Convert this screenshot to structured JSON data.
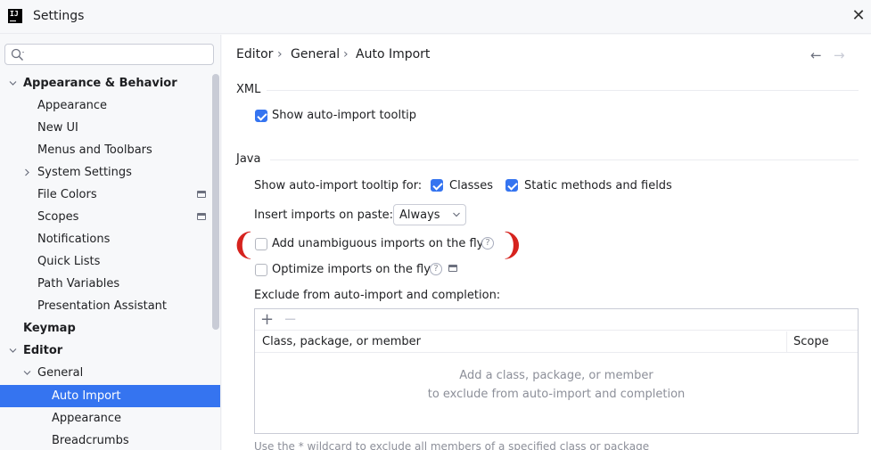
{
  "window": {
    "title": "Settings",
    "app_icon_text": "IJ"
  },
  "sidebar": {
    "search_placeholder": "",
    "items": [
      {
        "label": "Appearance & Behavior",
        "level": 0,
        "expanded": true,
        "bold": true
      },
      {
        "label": "Appearance",
        "level": 1
      },
      {
        "label": "New UI",
        "level": 1
      },
      {
        "label": "Menus and Toolbars",
        "level": 1
      },
      {
        "label": "System Settings",
        "level": 1,
        "expandable": true
      },
      {
        "label": "File Colors",
        "level": 1,
        "icon": "project-settings-icon"
      },
      {
        "label": "Scopes",
        "level": 1,
        "icon": "project-settings-icon"
      },
      {
        "label": "Notifications",
        "level": 1
      },
      {
        "label": "Quick Lists",
        "level": 1
      },
      {
        "label": "Path Variables",
        "level": 1
      },
      {
        "label": "Presentation Assistant",
        "level": 1
      },
      {
        "label": "Keymap",
        "level": 0,
        "bold": true
      },
      {
        "label": "Editor",
        "level": 0,
        "expanded": true,
        "bold": true
      },
      {
        "label": "General",
        "level": 1,
        "expanded": true
      },
      {
        "label": "Auto Import",
        "level": 2,
        "selected": true
      },
      {
        "label": "Appearance",
        "level": 2
      },
      {
        "label": "Breadcrumbs",
        "level": 2
      }
    ]
  },
  "breadcrumb": [
    "Editor",
    "General",
    "Auto Import"
  ],
  "xml": {
    "title": "XML",
    "show_tooltip_label": "Show auto-import tooltip",
    "show_tooltip_checked": true
  },
  "java": {
    "title": "Java",
    "tooltip_for_label": "Show auto-import tooltip for:",
    "classes_label": "Classes",
    "classes_checked": true,
    "static_label": "Static methods and fields",
    "static_checked": true,
    "insert_label": "Insert imports on paste:",
    "insert_value": "Always",
    "unambiguous_label": "Add unambiguous imports on the fly",
    "unambiguous_checked": false,
    "optimize_label": "Optimize imports on the fly",
    "optimize_checked": false,
    "exclude_label": "Exclude from auto-import and completion:",
    "table": {
      "col1": "Class, package, or member",
      "col2": "Scope",
      "empty_line1": "Add a class, package, or member",
      "empty_line2": "to exclude from auto-import and completion"
    },
    "hint": "Use the * wildcard to exclude all members of a specified class or package"
  },
  "colors": {
    "accent": "#3574f0",
    "highlight_annotation": "#d6231e"
  }
}
